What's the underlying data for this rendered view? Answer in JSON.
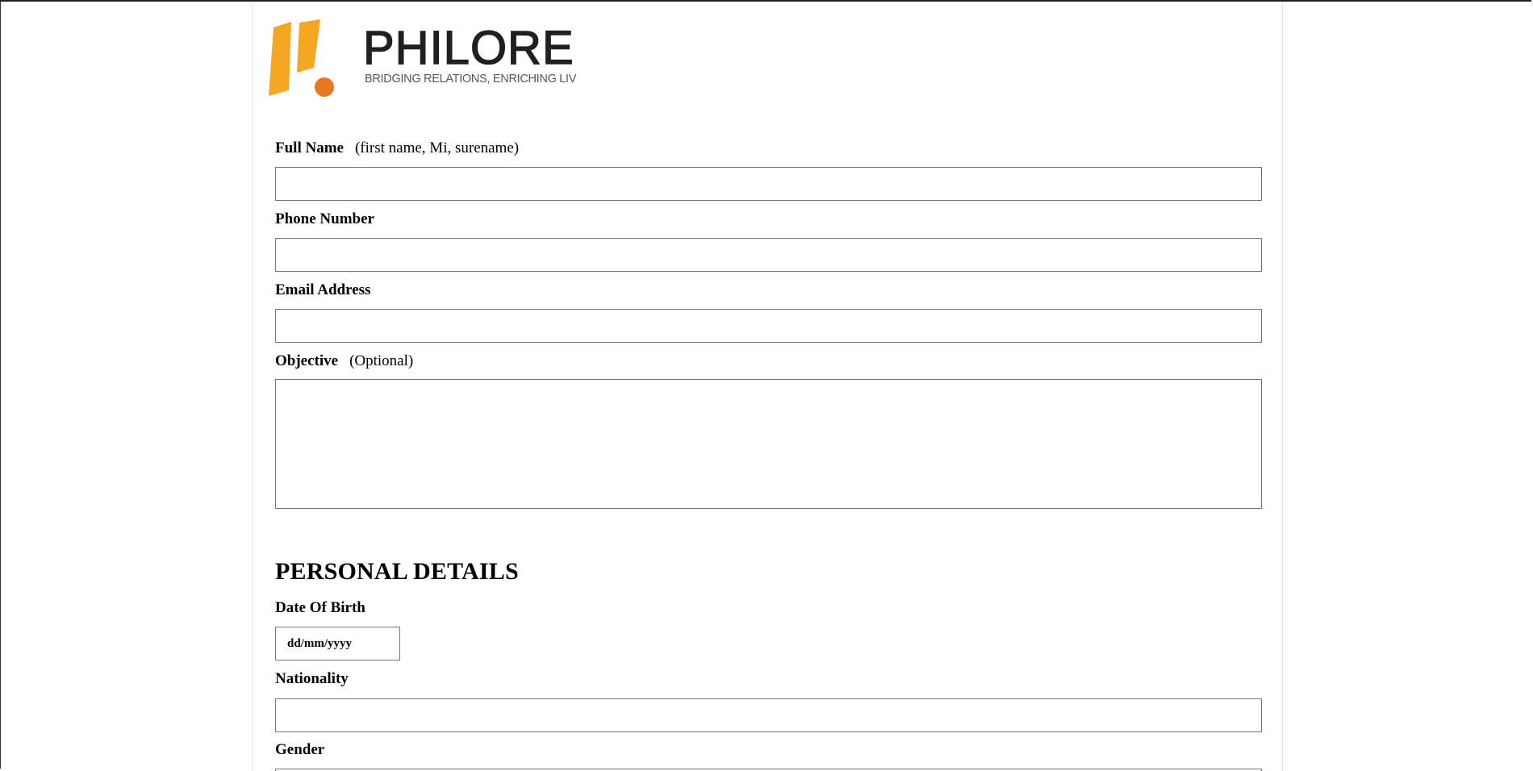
{
  "brand": {
    "name": "PHILORE",
    "tagline": "BRIDGING RELATIONS, ENRICHING LIVES",
    "colors": {
      "mark_yellow": "#F5A623",
      "mark_orange": "#E87722",
      "text": "#231F20"
    }
  },
  "form": {
    "full_name": {
      "label": "Full Name",
      "hint": "(first name, Mi, surename)",
      "value": ""
    },
    "phone": {
      "label": "Phone Number",
      "value": ""
    },
    "email": {
      "label": "Email Address",
      "value": ""
    },
    "objective": {
      "label": "Objective",
      "hint": "(Optional)",
      "value": ""
    }
  },
  "personal_details": {
    "heading": "PERSONAL DETAILS",
    "dob": {
      "label": "Date Of Birth",
      "placeholder": "dd/mm/yyyy"
    },
    "nationality": {
      "label": "Nationality",
      "value": ""
    },
    "gender": {
      "label": "Gender"
    }
  }
}
